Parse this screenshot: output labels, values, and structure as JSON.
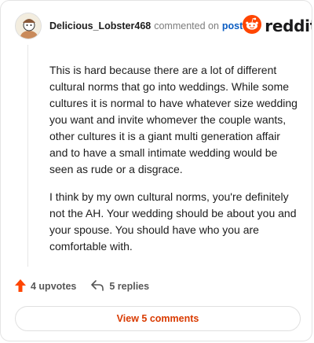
{
  "comment": {
    "username": "Delicious_Lobster468",
    "action_text": "commented on",
    "post_link": "post",
    "brand": "reddit",
    "paragraphs": [
      "This is hard because there are a lot of different cultural norms that go into weddings. While some cultures it is normal to have whatever size wedding you want and invite whomever the couple wants, other cultures it is a giant multi generation affair and to have a small intimate wedding would be seen as rude or a disgrace.",
      "I think by my own cultural norms, you're definitely not the AH. Your wedding should be about you and your spouse. You should have who you are comfortable with."
    ]
  },
  "actions": {
    "upvotes": "4 upvotes",
    "replies": "5 replies"
  },
  "view_button": "View 5 comments",
  "colors": {
    "brand_orange": "#ff4500",
    "link_blue": "#0a5cc2",
    "view_text": "#d93a00"
  },
  "icons": [
    "avatar",
    "reddit-logo-icon",
    "upvote-arrow-icon",
    "reply-arrow-icon"
  ]
}
